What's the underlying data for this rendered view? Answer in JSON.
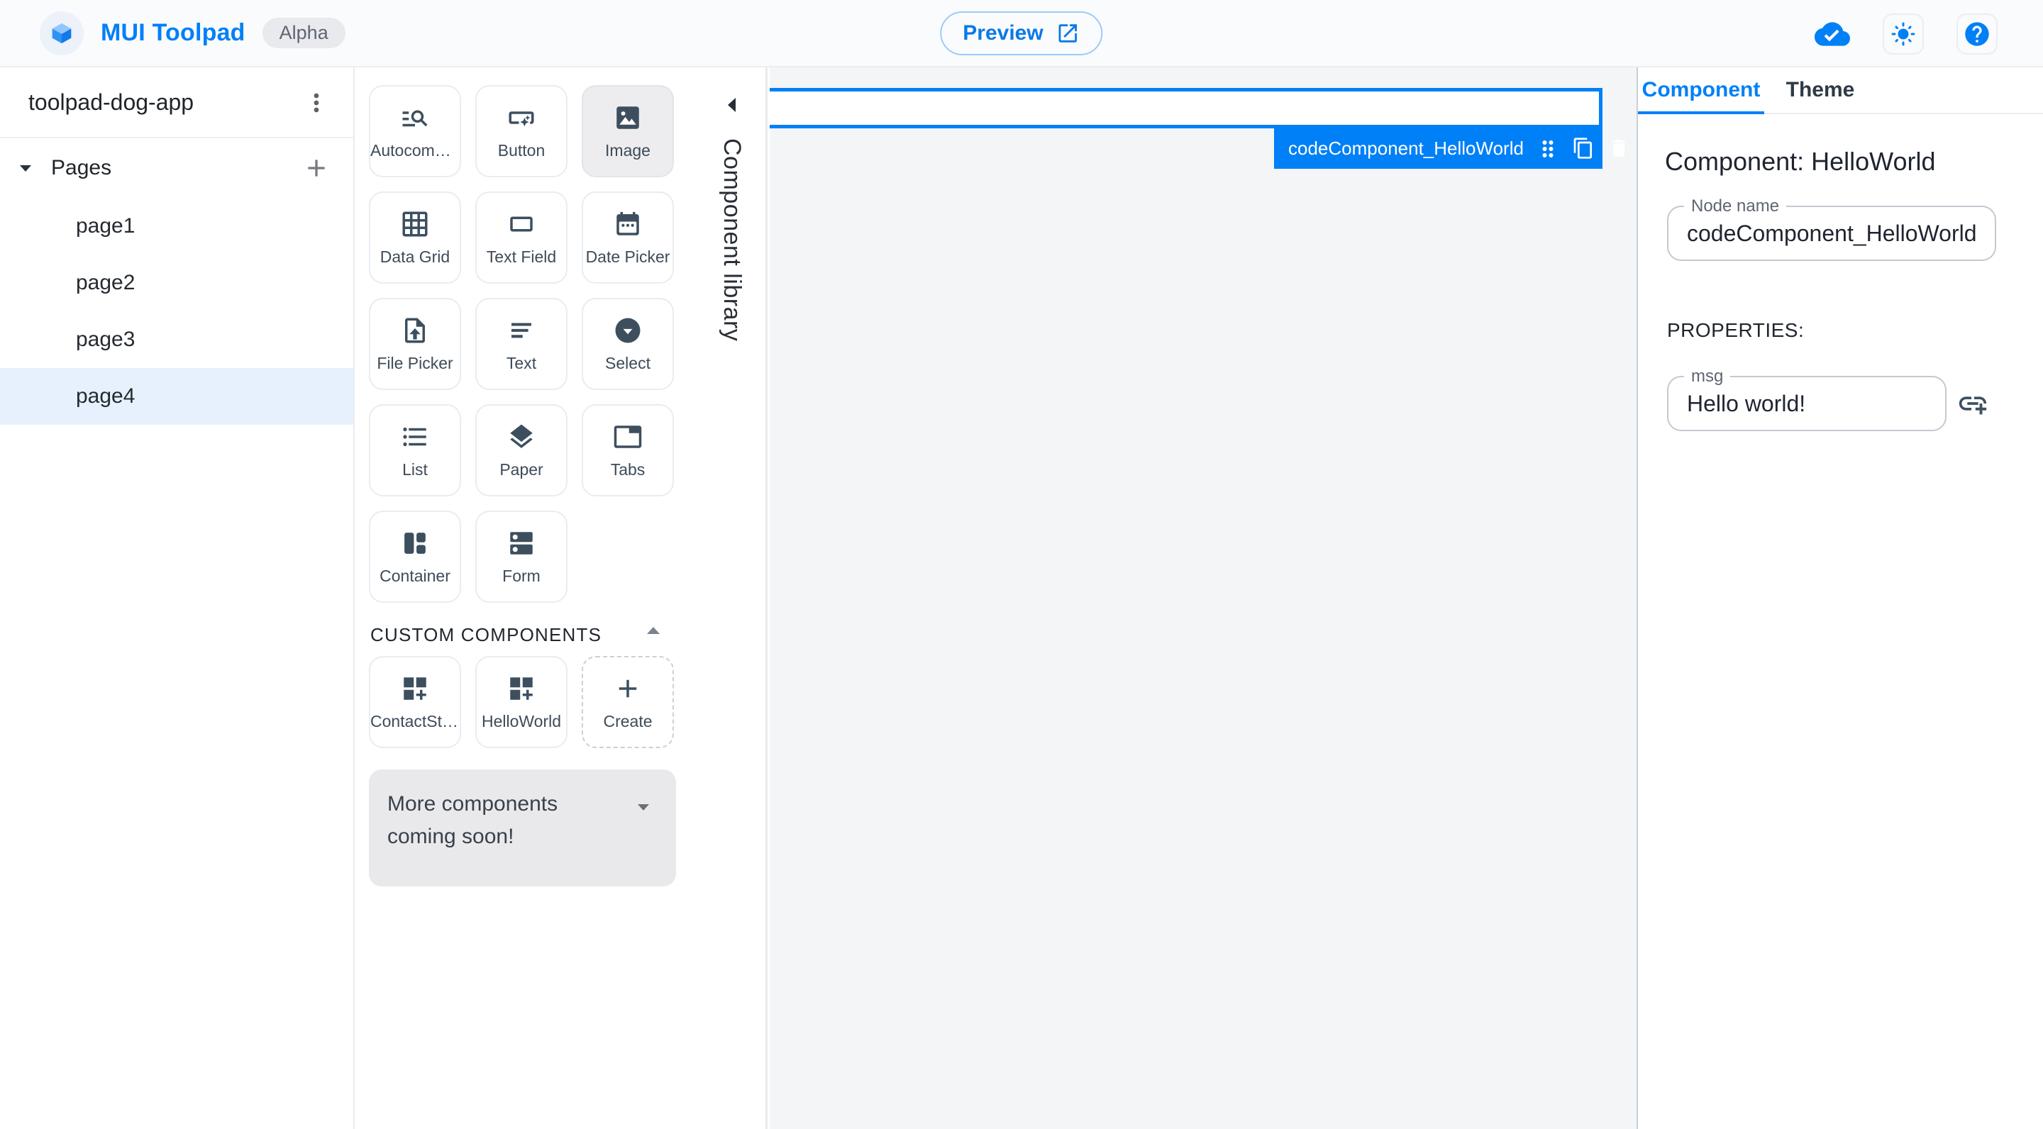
{
  "colors": {
    "primary_blue": "#0080f7",
    "selection_blue": "#0080f7",
    "icon_slate": "#3e5060",
    "canvas_background": "#f4f5f6",
    "selected_page_background": "#e7f1fd"
  },
  "header": {
    "app_title": "MUI Toolpad",
    "badge": "Alpha",
    "preview_label": "Preview"
  },
  "sidebar": {
    "app_name": "toolpad-dog-app",
    "pages_label": "Pages",
    "pages": [
      {
        "label": "page1",
        "selected": false
      },
      {
        "label": "page2",
        "selected": false
      },
      {
        "label": "page3",
        "selected": false
      },
      {
        "label": "page4",
        "selected": true
      }
    ]
  },
  "library": {
    "panel_label": "Component library",
    "components": [
      {
        "label": "Autocomplete",
        "icon": "autocomplete",
        "selected": false
      },
      {
        "label": "Button",
        "icon": "button",
        "selected": false
      },
      {
        "label": "Image",
        "icon": "image",
        "selected": true
      },
      {
        "label": "Data Grid",
        "icon": "data-grid",
        "selected": false
      },
      {
        "label": "Text Field",
        "icon": "text-field",
        "selected": false
      },
      {
        "label": "Date Picker",
        "icon": "date-picker",
        "selected": false
      },
      {
        "label": "File Picker",
        "icon": "file-picker",
        "selected": false
      },
      {
        "label": "Text",
        "icon": "text",
        "selected": false
      },
      {
        "label": "Select",
        "icon": "select",
        "selected": false
      },
      {
        "label": "List",
        "icon": "list",
        "selected": false
      },
      {
        "label": "Paper",
        "icon": "paper",
        "selected": false
      },
      {
        "label": "Tabs",
        "icon": "tabs",
        "selected": false
      },
      {
        "label": "Container",
        "icon": "container",
        "selected": false
      },
      {
        "label": "Form",
        "icon": "form",
        "selected": false
      }
    ],
    "custom_header": "CUSTOM COMPONENTS",
    "custom_components": [
      {
        "label": "ContactSta…",
        "icon": "dashboard-customize",
        "dashed": false
      },
      {
        "label": "HelloWorld",
        "icon": "dashboard-customize",
        "dashed": false
      },
      {
        "label": "Create",
        "icon": "add",
        "dashed": true
      }
    ],
    "coming_soon": "More components coming soon!"
  },
  "canvas": {
    "selection_label": "codeComponent_HelloWorld"
  },
  "inspector": {
    "tab_component": "Component",
    "tab_theme": "Theme",
    "active_tab": "Component",
    "heading": "Component: HelloWorld",
    "node_name_label": "Node name",
    "node_name_value": "codeComponent_HelloWorld",
    "properties_header": "PROPERTIES:",
    "msg_label": "msg",
    "msg_value": "Hello world!"
  }
}
